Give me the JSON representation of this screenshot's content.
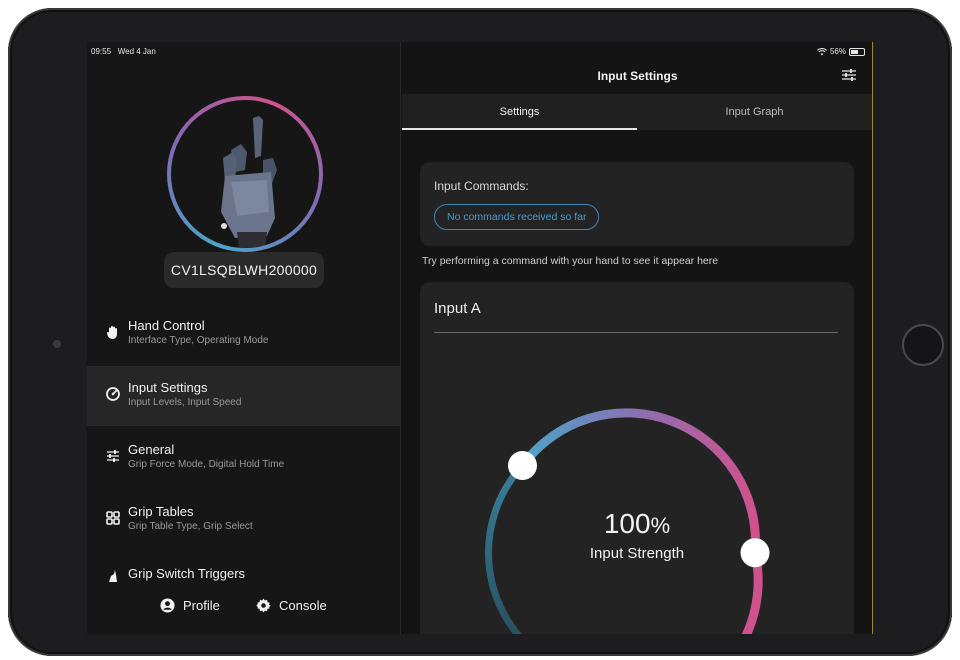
{
  "status_bar": {
    "time": "09:55",
    "date": "Wed 4 Jan",
    "battery": "56%",
    "battery_level": 0.56
  },
  "sidebar": {
    "device_id": "CV1LSQBLWH200000",
    "items": [
      {
        "title": "Hand Control",
        "subtitle": "Interface Type, Operating Mode",
        "icon": "hand-icon",
        "active": false
      },
      {
        "title": "Input Settings",
        "subtitle": "Input Levels, Input Speed",
        "icon": "gauge-icon",
        "active": true
      },
      {
        "title": "General",
        "subtitle": "Grip Force Mode, Digital Hold Time",
        "icon": "sliders-icon",
        "active": false
      },
      {
        "title": "Grip Tables",
        "subtitle": "Grip Table Type, Grip Select",
        "icon": "grid-icon",
        "active": false
      },
      {
        "title": "Grip Switch Triggers",
        "subtitle": "",
        "icon": "trigger-icon",
        "active": false
      }
    ],
    "footer": {
      "profile_label": "Profile",
      "console_label": "Console"
    }
  },
  "main": {
    "title": "Input Settings",
    "tabs": [
      {
        "label": "Settings",
        "active": true
      },
      {
        "label": "Input Graph",
        "active": false
      }
    ],
    "commands": {
      "label": "Input Commands:",
      "pill": "No commands received so far"
    },
    "hint": "Try performing a command with your hand to see it appear here",
    "input_card": {
      "title": "Input A",
      "value": "100",
      "unit": "%",
      "label": "Input Strength"
    }
  },
  "colors": {
    "accent_blue": "#4a9bd0",
    "gradient_start": "#4aa6c8",
    "gradient_end": "#d0528c"
  }
}
